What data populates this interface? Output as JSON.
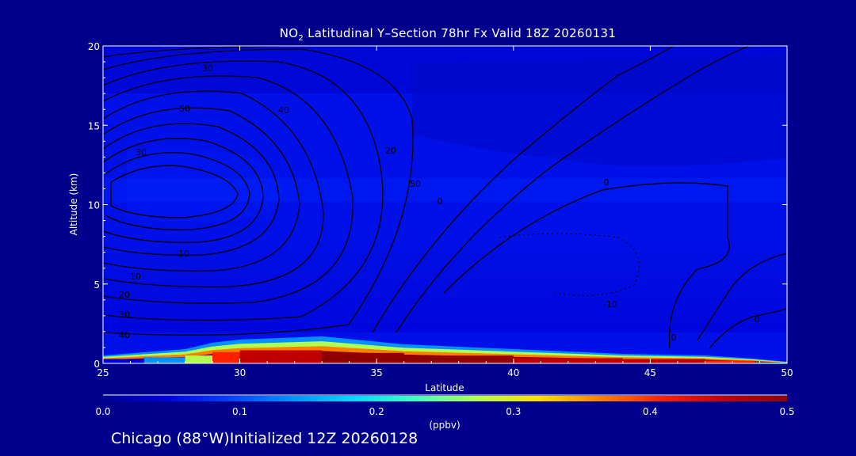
{
  "chart_data": {
    "type": "heatmap",
    "title": {
      "prefix": "NO",
      "subscript": "2",
      "rest": " Latitudinal Y–Section 78hr  Fx Valid 18Z 20260131"
    },
    "xlabel": "Latitude",
    "ylabel": "Altitude (km)",
    "xlim": [
      25,
      50
    ],
    "ylim": [
      0,
      20
    ],
    "x_ticks": [
      "25",
      "30",
      "35",
      "40",
      "45",
      "50"
    ],
    "y_ticks": [
      "0",
      "5",
      "10",
      "15",
      "20"
    ],
    "colorbar": {
      "label": "(ppbv)",
      "range": [
        0.0,
        0.5
      ],
      "tick_labels": [
        "0.0",
        "0.1",
        "0.2",
        "0.3",
        "0.4",
        "0.5"
      ],
      "colors": [
        "#000090",
        "#0000dc",
        "#0040ff",
        "#0090ff",
        "#00d8ff",
        "#40ffc0",
        "#b0ff50",
        "#ffe000",
        "#ff8000",
        "#ff2000",
        "#c00000",
        "#900000"
      ]
    },
    "field": {
      "background_value": 0.03,
      "surface_layer": [
        {
          "lat": 25,
          "top_km": 0.5,
          "value": 0.05
        },
        {
          "lat": 26.5,
          "top_km": 0.7,
          "value": 0.08
        },
        {
          "lat": 28,
          "top_km": 0.9,
          "value": 0.2
        },
        {
          "lat": 29,
          "top_km": 1.3,
          "value": 0.35
        },
        {
          "lat": 30,
          "top_km": 1.5,
          "value": 0.45
        },
        {
          "lat": 33,
          "top_km": 1.7,
          "value": 0.5
        },
        {
          "lat": 36,
          "top_km": 1.2,
          "value": 0.48
        },
        {
          "lat": 40,
          "top_km": 0.9,
          "value": 0.48
        },
        {
          "lat": 44,
          "top_km": 0.6,
          "value": 0.46
        },
        {
          "lat": 47,
          "top_km": 0.5,
          "value": 0.45
        },
        {
          "lat": 48.8,
          "top_km": 0.3,
          "value": 0.35
        },
        {
          "lat": 50,
          "top_km": 0.1,
          "value": 0.02
        }
      ]
    },
    "contour_labels": [
      "30",
      "50",
      "40",
      "30",
      "20",
      "10",
      "10",
      "20",
      "30",
      "40",
      "50",
      "0",
      "0",
      "0",
      "-10",
      "0"
    ]
  },
  "footer": {
    "text": "Chicago (88°W)Initialized 12Z 20260128"
  }
}
